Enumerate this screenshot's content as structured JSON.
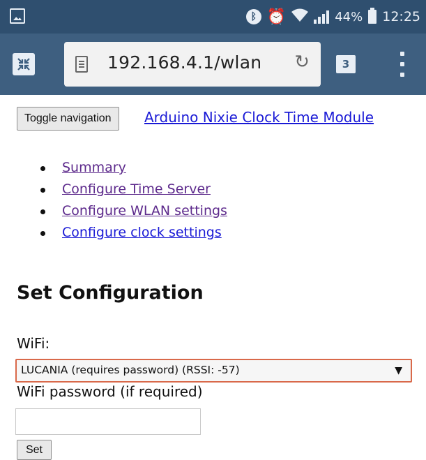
{
  "status_bar": {
    "battery_percent": "44%",
    "time": "12:25",
    "icons": [
      "gallery-icon",
      "bluetooth-icon",
      "alarm-icon",
      "wifi-icon",
      "signal-icon",
      "battery-icon"
    ]
  },
  "browser": {
    "url": "192.168.4.1/wlan",
    "tab_count": "3",
    "icons": [
      "collapse-icon",
      "page-icon",
      "reload-icon",
      "tabs-icon",
      "menu-icon"
    ]
  },
  "page": {
    "nav_toggle_label": "Toggle navigation",
    "brand": "Arduino Nixie Clock Time Module",
    "menu": [
      {
        "label": "Summary",
        "visited": true
      },
      {
        "label": "Configure Time Server",
        "visited": true
      },
      {
        "label": "Configure WLAN settings",
        "visited": true
      },
      {
        "label": "Configure clock settings",
        "visited": false
      }
    ],
    "heading": "Set Configuration",
    "wifi_label": "WiFi:",
    "wifi_selected": "LUCANIA (requires password) (RSSI: -57)",
    "password_label": "WiFi password (if required)",
    "password_value": "",
    "set_button": "Set"
  },
  "colors": {
    "status_bar_bg": "#2f4f6f",
    "toolbar_bg": "#3e5f80",
    "link": "#1a1ad6",
    "visited_link": "#5d2a8c",
    "select_focus_border": "#d9694a"
  }
}
